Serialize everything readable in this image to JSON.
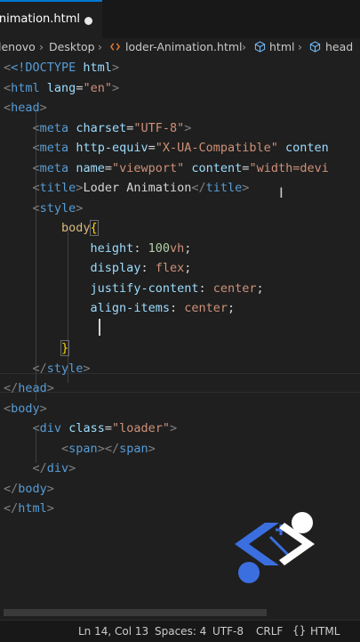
{
  "tab": {
    "title": "Animation.html"
  },
  "breadcrumb": {
    "items": [
      "lenovo",
      "Desktop",
      "loder-Animation.html",
      "html",
      "head"
    ]
  },
  "code": {
    "l1_doctype": "<!DOCTYPE",
    "l1_html": " html",
    "l1_close": ">",
    "lang_attr": "lang",
    "lang_val": "\"en\"",
    "head": "head",
    "meta": "meta",
    "charset_attr": "charset",
    "charset_val": "\"UTF-8\"",
    "http_equiv_attr": "http-equiv",
    "http_equiv_val": "\"X-UA-Compatible\"",
    "content_attr_partial": "conten",
    "name_attr": "name",
    "name_val": "\"viewport\"",
    "content_attr": "content",
    "content_val_partial": "\"width=devi",
    "title_tag": "title",
    "title_text": "Loder Animation",
    "style_tag": "style",
    "body_sel": "body",
    "prop_height": "height",
    "val_height_num": "100",
    "val_height_unit": "vh",
    "prop_display": "display",
    "val_display": "flex",
    "prop_justify": "justify-content",
    "val_justify": "center",
    "prop_align": "align-items",
    "val_align": "center",
    "body_tag": "body",
    "div_tag": "div",
    "class_attr": "class",
    "class_val": "\"loader\"",
    "span_tag": "span",
    "html_tag": "html"
  },
  "status": {
    "position": "Ln 14, Col 13",
    "spaces": "Spaces: 4",
    "encoding": "UTF-8",
    "eol": "CRLF",
    "language_mode": "HTML"
  },
  "colors": {
    "editor_bg": "#1f1f1f",
    "tag": "#569cd6",
    "attribute": "#9cdcfe",
    "string": "#ce9178",
    "selector": "#d7ba7d",
    "number": "#b5cea8",
    "brace": "#ffd700",
    "logo": "#3b6fe0"
  }
}
